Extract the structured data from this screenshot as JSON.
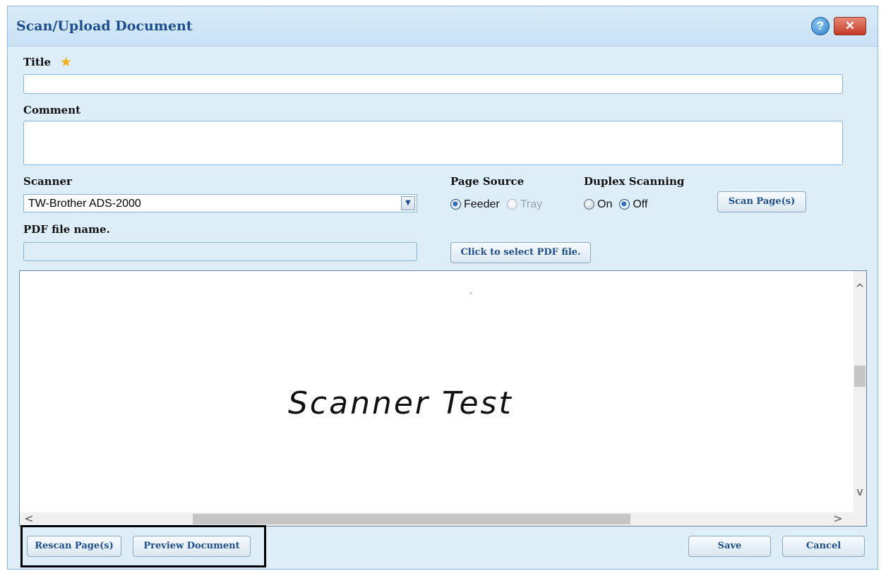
{
  "dialog": {
    "title": "Scan/Upload Document",
    "help_symbol": "?",
    "close_symbol": "✕"
  },
  "form": {
    "title_label": "Title",
    "title_value": "",
    "comment_label": "Comment",
    "comment_value": "",
    "scanner_label": "Scanner",
    "scanner_value": "TW-Brother ADS-2000",
    "page_source_label": "Page Source",
    "page_source_options": [
      {
        "label": "Feeder",
        "checked": true,
        "disabled": false
      },
      {
        "label": "Tray",
        "checked": false,
        "disabled": true
      }
    ],
    "duplex_label": "Duplex Scanning",
    "duplex_options": [
      {
        "label": "On",
        "checked": false
      },
      {
        "label": "Off",
        "checked": true
      }
    ],
    "scan_button": "Scan Page(s)",
    "pdf_label": "PDF file name.",
    "pdf_value": "",
    "select_pdf_button": "Click to select PDF file."
  },
  "preview": {
    "text": "Scanner Test",
    "scroll_up": "^",
    "scroll_down": "v",
    "scroll_left": "<",
    "scroll_right": ">"
  },
  "footer": {
    "rescan_button": "Rescan Page(s)",
    "preview_button": "Preview Document",
    "save_button": "Save",
    "cancel_button": "Cancel"
  },
  "icons": {
    "required": "star-icon",
    "help": "help-icon",
    "close": "close-icon",
    "dropdown": "chevron-down-icon"
  },
  "colors": {
    "dialog_bg": "#ddeef9",
    "title": "#1f4e8c",
    "star": "#f4b21a",
    "close": "#c53a26"
  }
}
